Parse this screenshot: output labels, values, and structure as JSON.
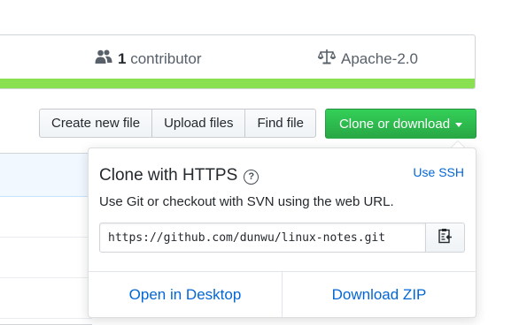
{
  "summary": {
    "contributors_count": "1",
    "contributors_label": "contributor",
    "license": "Apache-2.0",
    "contributors_icon": "people-icon",
    "license_icon": "law-icon",
    "language_bar_color": "#89e051"
  },
  "toolbar": {
    "create_new_file": "Create new file",
    "upload_files": "Upload files",
    "find_file": "Find file",
    "clone_or_download": "Clone or download"
  },
  "clone_dropdown": {
    "title": "Clone with HTTPS",
    "use_ssh": "Use SSH",
    "description": "Use Git or checkout with SVN using the web URL.",
    "url": "https://github.com/dunwu/linux-notes.git",
    "open_in_desktop": "Open in Desktop",
    "download_zip": "Download ZIP",
    "help_icon": "question-icon",
    "copy_icon": "clipboard-icon"
  },
  "colors": {
    "primary": "#28a745",
    "link": "#0366d6"
  }
}
